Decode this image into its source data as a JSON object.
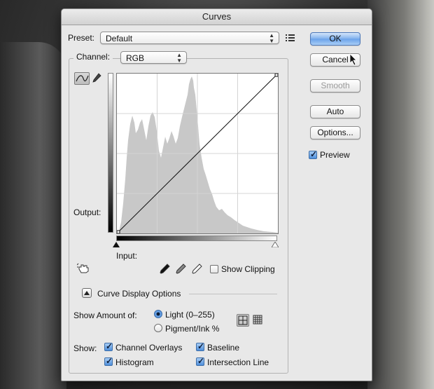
{
  "window": {
    "title": "Curves"
  },
  "preset": {
    "label": "Preset:",
    "value": "Default"
  },
  "channel": {
    "label": "Channel:",
    "value": "RGB"
  },
  "buttons": {
    "ok": "OK",
    "cancel": "Cancel",
    "smooth": "Smooth",
    "auto": "Auto",
    "options": "Options..."
  },
  "preview": {
    "label": "Preview",
    "checked": true
  },
  "graph": {
    "output_label": "Output:",
    "input_label": "Input:"
  },
  "show_clipping": {
    "label": "Show Clipping",
    "checked": false
  },
  "curve_display": {
    "label": "Curve Display Options"
  },
  "show_amount": {
    "label": "Show Amount of:",
    "light": "Light  (0–255)",
    "pigment": "Pigment/Ink %",
    "selected": "light"
  },
  "show": {
    "label": "Show:",
    "channel_overlays": "Channel Overlays",
    "baseline": "Baseline",
    "histogram": "Histogram",
    "intersection_line": "Intersection Line"
  },
  "icons": {
    "preset_menu": "preset-options-icon",
    "curve_tool": "curve-points-icon",
    "pencil_tool": "pencil-icon",
    "on_image": "targeted-adjustment-hand-icon",
    "black_point": "black-point-eyedropper-icon",
    "gray_point": "gray-point-eyedropper-icon",
    "white_point": "white-point-eyedropper-icon",
    "grid_simple": "grid-4x4-icon",
    "grid_detailed": "grid-10x10-icon"
  },
  "colors": {
    "accent": "#6aa3ea",
    "histogram": "#c8c8c8"
  }
}
